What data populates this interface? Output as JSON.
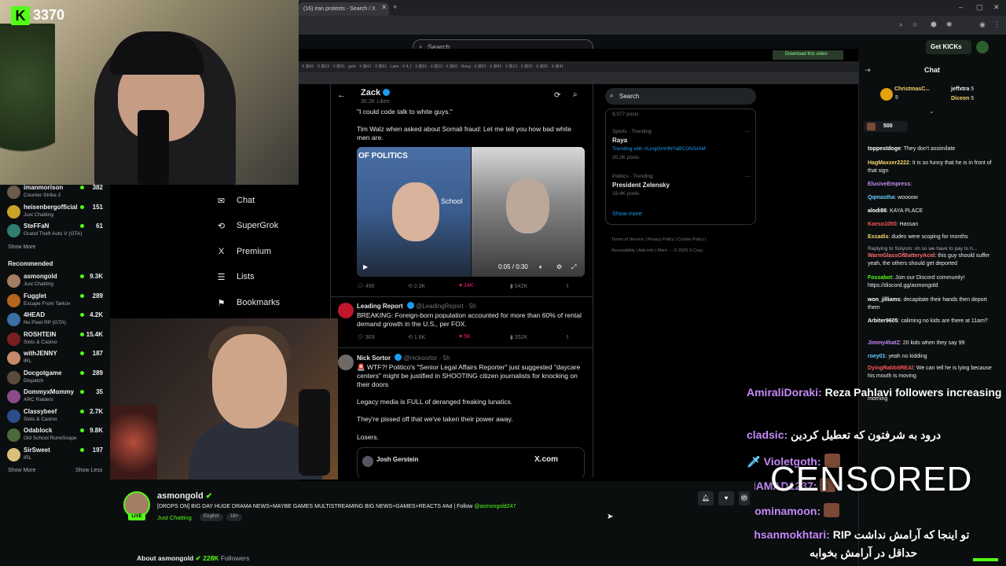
{
  "kick": {
    "logo_letter": "K",
    "count": "3370",
    "search_placeholder": "Search",
    "get_kicks": "Get KICKs"
  },
  "browser": {
    "tab_title": "(16) iran protests - Search / X",
    "download_notice": "Download this video",
    "bookmarks_strip": "X  获91 ·  X  获13 ·  X  获91 ·  gelo ·  X  获41 ·  X  获91 ·  Lake ·  X  4_f ·  X  获91 ·  X  获13 ·  X  获91 ·  Bong ·  X  获91 ·  X  获41 ·  X  获13 ·  X  获91 ·  X  获91 ·  X  获41"
  },
  "sidebar": {
    "channels_top": [
      {
        "name": "imanmorison",
        "category": "Counter-Strike 2",
        "viewers": "382",
        "color": "#6a5b4d"
      },
      {
        "name": "heisenbergofficial",
        "category": "Just Chatting",
        "viewers": "151",
        "color": "#c9a227"
      },
      {
        "name": "SteFFaN",
        "category": "Grand Theft Auto V (GTA)",
        "viewers": "61",
        "color": "#2e7d6e"
      }
    ],
    "show_more": "Show More",
    "recommended_heading": "Recommended",
    "recommended": [
      {
        "name": "asmongold",
        "category": "Just Chatting",
        "viewers": "9.3K",
        "color": "#a47d63"
      },
      {
        "name": "Fugglet",
        "category": "Escape From Tarkov",
        "viewers": "289",
        "color": "#b5651d"
      },
      {
        "name": "4HEAD",
        "category": "No Pixel RP (GTA)",
        "viewers": "4.2K",
        "color": "#3a6ea5"
      },
      {
        "name": "ROSHTEIN",
        "category": "Slots & Casino",
        "viewers": "15.4K",
        "color": "#7a1f1f"
      },
      {
        "name": "withJENNY",
        "category": "IRL",
        "viewers": "187",
        "color": "#c48a6a"
      },
      {
        "name": "Docgotgame",
        "category": "Dispatch",
        "viewers": "289",
        "color": "#5b4b3b"
      },
      {
        "name": "DommyxMommy",
        "category": "ARC Raiders",
        "viewers": "35",
        "color": "#8a4a8a"
      },
      {
        "name": "Classybeef",
        "category": "Slots & Casino",
        "viewers": "2.7K",
        "color": "#2d4d8a"
      },
      {
        "name": "Odablock",
        "category": "Old School RuneScape",
        "viewers": "9.8K",
        "color": "#4a6a3a"
      },
      {
        "name": "SirSweet",
        "category": "IRL",
        "viewers": "197",
        "color": "#d8c07a"
      }
    ],
    "show_more_bottom": "Show More",
    "show_less": "Show Less"
  },
  "x_nav": [
    {
      "icon": "✉",
      "label": "Chat"
    },
    {
      "icon": "⟲",
      "label": "SuperGrok"
    },
    {
      "icon": "X",
      "label": "Premium"
    },
    {
      "icon": "☰",
      "label": "Lists"
    },
    {
      "icon": "⚑",
      "label": "Bookmarks"
    }
  ],
  "x_post": {
    "author": "Zack",
    "likes_line": "30.2K Likes",
    "quote": "\"I could code talk to white guys.\"",
    "text": "Tim Walz when asked about Somali fraud: Let me tell you how bad white men are.",
    "video_tag": "OF POLITICS",
    "video_tag2": "School",
    "video_time": "0:05 / 0:30",
    "actions": {
      "replies": "490",
      "reposts": "2.3K",
      "likes": "14K",
      "views": "542K"
    }
  },
  "x_tweet2": {
    "author": "Leading Report",
    "handle": "@LeadingReport · 5h",
    "text": "BREAKING: Foreign-born population accounted for more than 60% of rental demand growth in the U.S., per FOX.",
    "actions": {
      "replies": "303",
      "reposts": "1.6K",
      "likes": "5K",
      "views": "352K"
    }
  },
  "x_tweet3": {
    "author": "Nick Sortor",
    "handle": "@nicksortor · 5h",
    "text1": "🚨 WTF?! Politico's \"Senior Legal Affairs Reporter\" just suggested \"daycare centers\" might be justified in SHOOTING citizen journalists for knocking on their doors",
    "text2": "Legacy media is FULL of deranged freaking lunatics.",
    "text3": "They're pissed off that we've taken their power away.",
    "text4": "Losers.",
    "embed_author": "Josh Gerstein",
    "embed_site": "X.com"
  },
  "x_side": {
    "search_placeholder": "Search",
    "posts_count": "8,077 posts",
    "trend1_context": "Sports · Trending",
    "trend1_name": "Raya",
    "trend1_sub": "Trending with #LingOrnHNYaBCONSIAM",
    "trend1_posts": "20.2K posts",
    "trend2_context": "Politics · Trending",
    "trend2_name": "President Zelensky",
    "trend2_posts": "19.4K posts",
    "show_more": "Show more",
    "footer1": "Terms of Service  |  Privacy Policy  |  Cookie Policy  |",
    "footer2": "Accessibility  |  Ads info  |  More ···  © 2025 X Corp."
  },
  "chat": {
    "title": "Chat",
    "gifts": [
      {
        "name": "ChristmasC...",
        "count": "5"
      },
      {
        "name": "jeffxtra",
        "count": "5"
      },
      {
        "name": "Diceon",
        "count": "5"
      }
    ],
    "pinned_amount": "500",
    "messages": [
      {
        "user": "toppestdoge",
        "color": "#ffffff",
        "text": "They don't assimilate"
      },
      {
        "user": "HagMaxxer2222",
        "color": "#f5d76e",
        "text": "It is so funny that he is in front of that sign"
      },
      {
        "user": "ElusiveEmpress",
        "color": "#c58af9",
        "text": ""
      },
      {
        "user": "Qqmastha",
        "color": "#66ccff",
        "text": "woooow"
      },
      {
        "user": "alodi86",
        "color": "#ffffff",
        "text": "KAYA PLACE"
      },
      {
        "user": "Kaeso1050",
        "color": "#ff5555",
        "text": "Hassan"
      },
      {
        "user": "Essadis",
        "color": "#f5d76e",
        "text": "dudes were scoping for months"
      },
      {
        "user": "WarmGlassOfBatteryAcid",
        "color": "#ff6a6a",
        "text": "this guy should suffer yeah, the others should get deported"
      },
      {
        "user": "Fossabot",
        "color": "#53fc18",
        "text": "Join our Discord community! https://discord.gg/asmongold"
      },
      {
        "user": "won_jilliams",
        "color": "#ffffff",
        "text": "decapitate their hands then deport them"
      },
      {
        "user": "Arbiter9605",
        "color": "#ffffff",
        "text": "caliming no kids are there at 11am?"
      },
      {
        "user": "Jimmy4hatZ",
        "color": "#c58af9",
        "text": "20 kids when they say 99"
      },
      {
        "user": "roey01",
        "color": "#66ccff",
        "text": "yeah no kidding"
      },
      {
        "user": "DyingRabbitREAl",
        "color": "#ff5555",
        "text": "We can tell he is lying because his mouth is moving"
      }
    ],
    "reply_note": "Replying to Solyom: oh so we have to pay to h..."
  },
  "overlay": {
    "line1_user": "AmiraliDoraki:",
    "line1_text": "Reza Pahlavi followers increasing",
    "line2_user": "cladsic:",
    "line2_text": "درود به شرفتون که تعطیل کردین",
    "line3_user": "Violetgoth:",
    "line4_user": "MAMAD1237:",
    "line5_user": "Rominamoon:",
    "line6_user": "Ehsanmokhtari:",
    "line6_text": "RIP تو اینجا که آرامش نداشت",
    "line7_text": "حداقل در آرامش بخوابه",
    "censored": "CENSORED",
    "morning": "morning"
  },
  "stream": {
    "streamer": "asmongold",
    "title": "[DROPS ON] BIG DAY HUGE DRAMA NEWS+MAYBE GAMES MULTISTREAMING BIG NEWS+GAMES+REACTS #Ad | Follow",
    "title_link": "@asmongold247",
    "category": "Just Chatting",
    "tags": [
      "English",
      "18+"
    ],
    "live": "LIVE",
    "about_label": "About asmongold",
    "followers_count": "228K",
    "followers_label": "Followers"
  },
  "colors": {
    "kick_green": "#53fc18",
    "x_blue": "#1d9bf0",
    "like_pink": "#f91880"
  }
}
